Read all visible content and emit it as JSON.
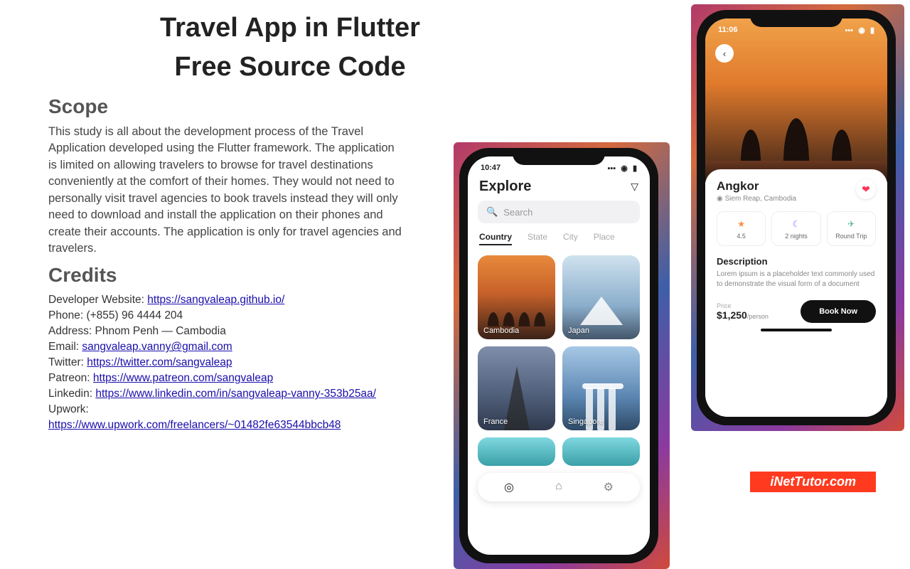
{
  "title": {
    "line1": "Travel App in Flutter",
    "line2": "Free Source Code"
  },
  "scope": {
    "heading": "Scope",
    "body": "This study is all about the development process of the Travel Application developed using the Flutter framework. The application is limited on allowing travelers to browse for travel destinations conveniently at the comfort of their homes. They would not need to personally visit travel agencies to book travels instead they will only need to download and install the application on their phones and create their accounts. The application is only for travel agencies and travelers."
  },
  "credits": {
    "heading": "Credits",
    "developer": {
      "label": "Developer Website: ",
      "url": "https://sangvaleap.github.io/"
    },
    "phone": {
      "label": "Phone: ",
      "value": "(+855) 96 4444 204"
    },
    "address": {
      "label": "Address: ",
      "value": "Phnom Penh — Cambodia"
    },
    "email": {
      "label": "Email: ",
      "url": "sangvaleap.vanny@gmail.com"
    },
    "twitter": {
      "label": "Twitter:  ",
      "url": "https://twitter.com/sangvaleap"
    },
    "patreon": {
      "label": "Patreon: ",
      "url": "https://www.patreon.com/sangvaleap"
    },
    "linkedin": {
      "label": "Linkedin: ",
      "url": "https://www.linkedin.com/in/sangvaleap-vanny-353b25aa/"
    },
    "upwork": {
      "label": "Upwork:",
      "url": "https://www.upwork.com/freelancers/~01482fe63544bbcb48"
    }
  },
  "phone1": {
    "time": "10:47",
    "signal": "▪▪▪",
    "wifi": "◉",
    "batt": "▮",
    "title": "Explore",
    "search_placeholder": "Search",
    "tabs": {
      "country": "Country",
      "state": "State",
      "city": "City",
      "place": "Place"
    },
    "cards": {
      "cambodia": "Cambodia",
      "japan": "Japan",
      "france": "France",
      "singapore": "Singapore"
    }
  },
  "phone2": {
    "time": "11:06",
    "place": "Angkor",
    "location": "Siem Reap, Cambodia",
    "chips": {
      "rating": "4.5",
      "nights": "2 nights",
      "trip": "Round Trip"
    },
    "desc_heading": "Description",
    "desc_body": "Lorem ipsum is a placeholder text commonly used to demonstrate the visual form of a document",
    "price_label": "Price",
    "price_value": "$1,250",
    "price_unit": "/person",
    "book": "Book Now"
  },
  "watermark": "iNetTutor.com"
}
